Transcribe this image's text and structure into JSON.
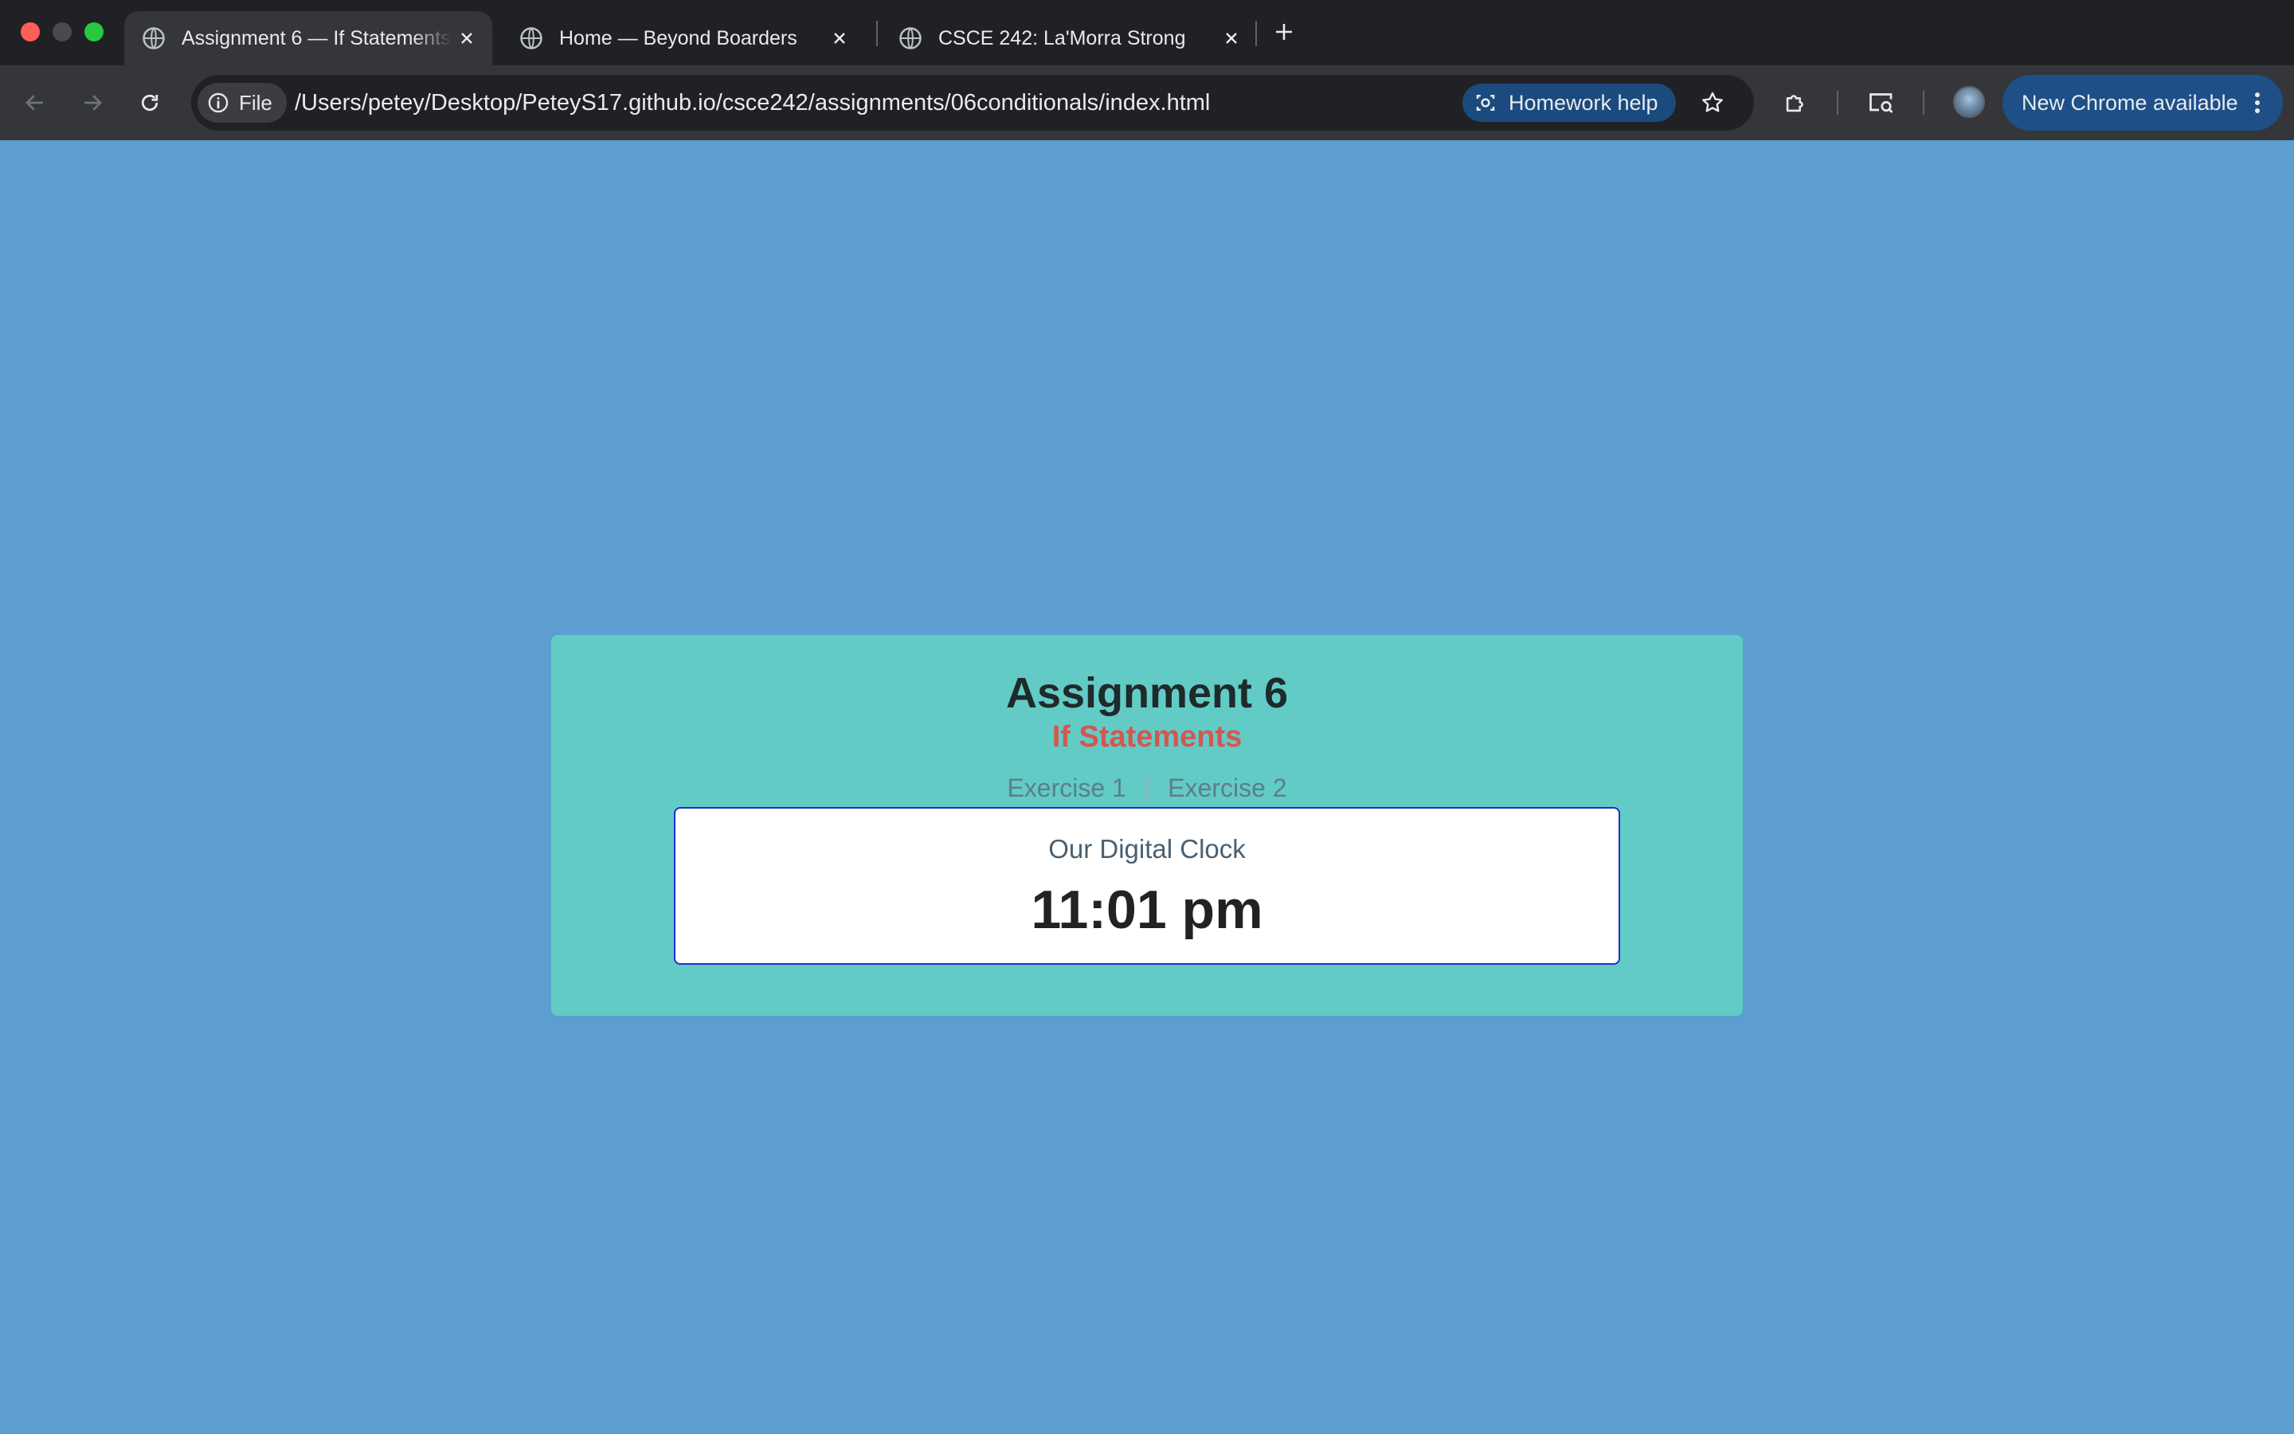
{
  "browser": {
    "tabs": [
      {
        "title": "Assignment 6 — If Statements",
        "active": true
      },
      {
        "title": "Home — Beyond Boarders",
        "active": false
      },
      {
        "title": "CSCE 242: La'Morra Strong",
        "active": false
      }
    ],
    "file_chip": "File",
    "url": "/Users/petey/Desktop/PeteyS17.github.io/csce242/assignments/06conditionals/index.html",
    "homework_help": "Homework help",
    "update_button": "New Chrome available",
    "colors": {
      "tabstrip": "#202124",
      "toolbar": "#35363a",
      "update_pill": "#1e4f87"
    }
  },
  "page": {
    "title": "Assignment 6",
    "subtitle": "If Statements",
    "links": [
      "Exercise 1",
      "Exercise 2"
    ],
    "link_separator": "|",
    "clock": {
      "label": "Our Digital Clock",
      "time": "11:01 pm"
    },
    "colors": {
      "background": "#5b9ecf",
      "card": "#62cbc6",
      "subtitle": "#d4574f",
      "clock_border": "#1c2fd1"
    }
  }
}
